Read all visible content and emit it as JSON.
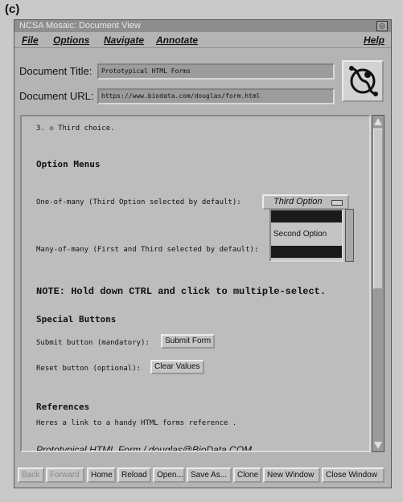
{
  "figure_label": "(c)",
  "window": {
    "title": "NCSA Mosaic: Document View",
    "close_glyph": "◎"
  },
  "menu": {
    "file": "File",
    "options": "Options",
    "navigate": "Navigate",
    "annotate": "Annotate",
    "help": "Help"
  },
  "fields": {
    "title_label": "Document Title:",
    "title_value": "Prototypical HTML Forms",
    "url_label": "Document URL:",
    "url_value": "https://www.biodata.com/douglas/form.html"
  },
  "content": {
    "choice_line": "3. ◇  Third choice.",
    "option_menus_heading": "Option Menus",
    "one_of_many_label": "One-of-many (Third Option selected by default):",
    "option_menu_value": "Third Option",
    "many_of_many_label": "Many-of-many (First and Third selected by default):",
    "list_options": [
      "",
      "Second Option",
      ""
    ],
    "note": "NOTE: Hold down CTRL and click to multiple-select.",
    "special_buttons_heading": "Special Buttons",
    "submit_label": "Submit button (mandatory):",
    "submit_button": "Submit Form",
    "reset_label": "Reset button (optional):",
    "reset_button": "Clear Values",
    "references_heading": "References",
    "references_text": "Heres a link to a handy HTML forms reference .",
    "footer_text": "Prototypical HTML Form / douglas@BioData.COM"
  },
  "toolbar": {
    "back": "Back",
    "forward": "Forward",
    "home": "Home",
    "reload": "Reload",
    "open": "Open...",
    "save_as": "Save As...",
    "clone": "Clone",
    "new_window": "New Window",
    "close_window": "Close Window"
  },
  "colors": {
    "window_bg": "#b4b4b4",
    "titlebar_bg": "#8e8e8e",
    "content_bg": "#bdbdbd"
  }
}
